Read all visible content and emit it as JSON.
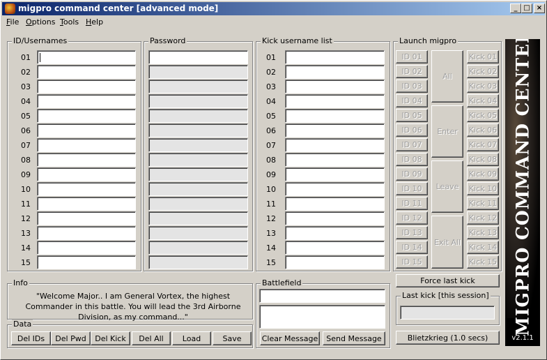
{
  "window": {
    "title": "migpro command center [advanced mode]",
    "minimize": "_",
    "maximize": "□",
    "close": "×"
  },
  "menu": [
    {
      "key": "F",
      "rest": "ile"
    },
    {
      "key": "O",
      "rest": "ptions"
    },
    {
      "key": "T",
      "rest": "ools"
    },
    {
      "key": "H",
      "rest": "elp"
    }
  ],
  "groups": {
    "ids": "ID/Usernames",
    "password": "Password",
    "kick": "Kick username list",
    "launch": "Launch migpro",
    "info": "Info",
    "battlefield": "Battlefield",
    "data": "Data",
    "last_kick": "Last kick [this session]"
  },
  "rows": [
    "01",
    "02",
    "03",
    "04",
    "05",
    "06",
    "07",
    "08",
    "09",
    "10",
    "11",
    "12",
    "13",
    "14",
    "15"
  ],
  "launch": {
    "id_buttons": [
      "ID 01",
      "ID 02",
      "ID 03",
      "ID 04",
      "ID 05",
      "ID 06",
      "ID 07",
      "ID 08",
      "ID 09",
      "ID 10",
      "ID 11",
      "ID 12",
      "ID 13",
      "ID 14",
      "ID 15"
    ],
    "kick_buttons": [
      "Kick 01",
      "Kick 02",
      "Kick 03",
      "Kick 04",
      "Kick 05",
      "Kick 06",
      "Kick 07",
      "Kick 08",
      "Kick 09",
      "Kick 10",
      "Kick 11",
      "Kick 12",
      "Kick 13",
      "Kick 14",
      "Kick 15"
    ],
    "all": "All",
    "enter": "Enter",
    "leave": "Leave",
    "exit_all": "Exit All",
    "force_last_kick": "Force last kick",
    "blitz": "Blietzkrieg (1.0 secs)"
  },
  "info": {
    "message": "\"Welcome Major.. I am General Vortex, the highest Commander in this battle. You will lead the 3rd Airborne Division, as my command...\""
  },
  "data_buttons": {
    "del_ids": "Del IDs",
    "del_pwd": "Del Pwd",
    "del_kick": "Del Kick",
    "del_all": "Del All",
    "load": "Load",
    "save": "Save"
  },
  "battlefield": {
    "clear": "Clear Message",
    "send": "Send Message"
  },
  "banner": {
    "text": "MIGPRO COMMAND CENTER",
    "version": "v2.1.1"
  }
}
